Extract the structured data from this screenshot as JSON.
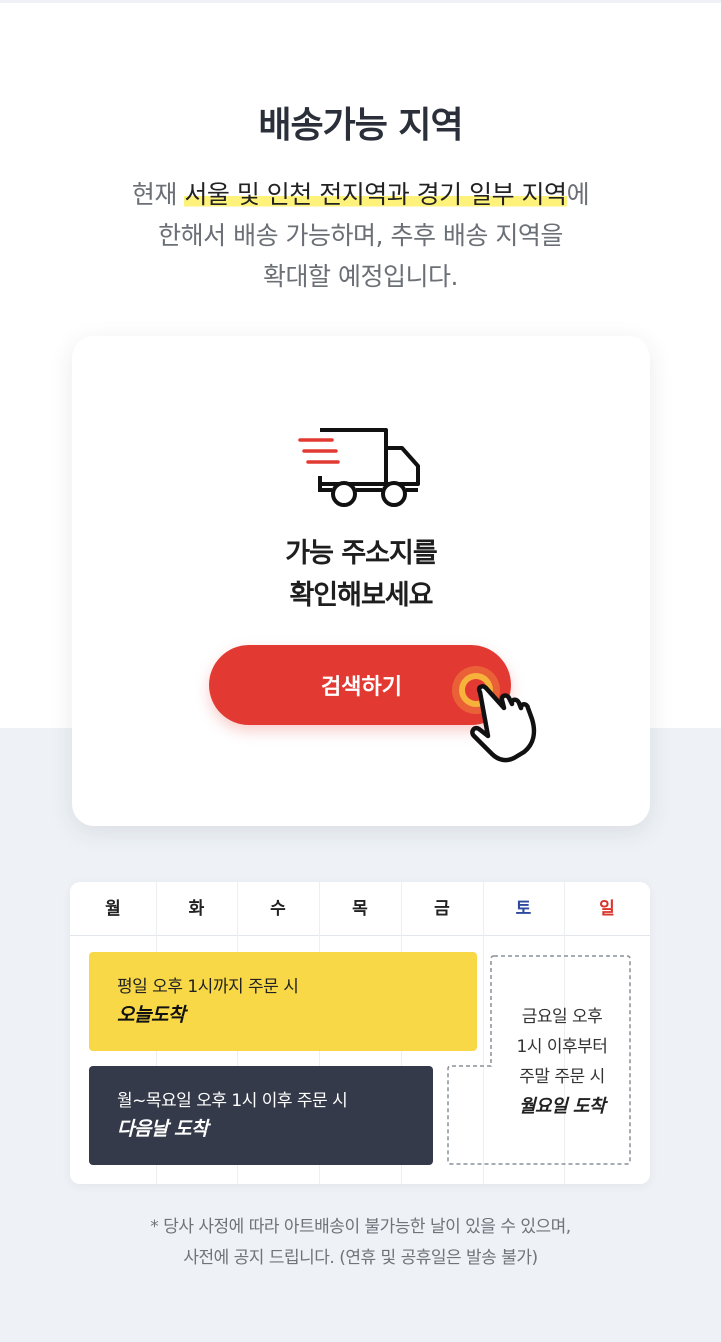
{
  "header": {
    "title": "배송가능 지역",
    "desc_prefix": "현재 ",
    "desc_highlight": "서울 및 인천 전지역과 경기 일부 지역",
    "desc_suffix": "에",
    "desc_line2": "한해서 배송 가능하며, 추후 배송 지역을",
    "desc_line3": "확대할 예정입니다."
  },
  "card": {
    "icon": "delivery-truck-icon",
    "line1": "가능 주소지를",
    "line2": "확인해보세요",
    "button_label": "검색하기",
    "pointer_icon": "hand-pointer-icon"
  },
  "colors": {
    "accent_red": "#e23a33",
    "highlight_yellow": "#fff27a",
    "box_yellow": "#f8d847",
    "box_dark": "#343a4a",
    "saturday_blue": "#2d4aa0",
    "sunday_red": "#d9342b"
  },
  "schedule": {
    "days": [
      "월",
      "화",
      "수",
      "목",
      "금",
      "토",
      "일"
    ],
    "same_day": {
      "line1": "평일 오후 1시까지 주문 시",
      "line2": "오늘도착"
    },
    "next_day": {
      "line1": "월~목요일 오후 1시 이후 주문 시",
      "line2": "다음날 도착"
    },
    "weekend": {
      "line1": "금요일 오후",
      "line2": "1시 이후부터",
      "line3": "주말 주문 시",
      "line4": "월요일 도착"
    }
  },
  "footer": {
    "note_line1": "* 당사 사정에 따라 아트배송이 불가능한 날이 있을 수 있으며,",
    "note_line2": "사전에 공지 드립니다. (연휴 및 공휴일은 발송 불가)"
  }
}
